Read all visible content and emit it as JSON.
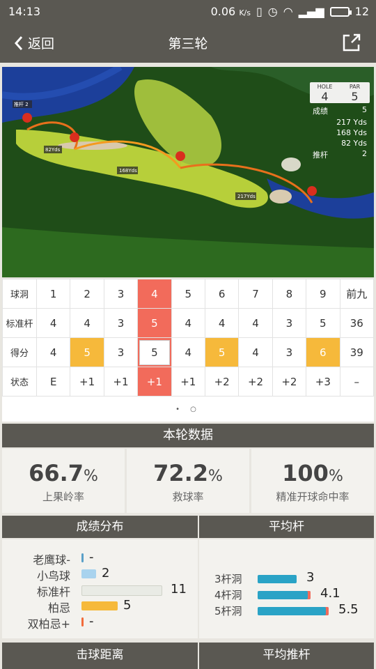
{
  "status_bar": {
    "time": "14:13",
    "speed": "0.06",
    "speed_unit": "K/s",
    "battery": "12"
  },
  "navbar": {
    "back_label": "返回",
    "title": "第三轮",
    "share_icon": "share-icon"
  },
  "map": {
    "putt_label": "推杆 2",
    "distances": [
      "82Yds",
      "168Yds",
      "217Yds"
    ],
    "hole_label": "HOLE",
    "hole": "4",
    "par_label": "PAR",
    "par": "5",
    "info": [
      {
        "k": "成绩",
        "v": "5"
      },
      {
        "k": "",
        "v": "217  Yds"
      },
      {
        "k": "",
        "v": "168  Yds"
      },
      {
        "k": "",
        "v": "82  Yds"
      },
      {
        "k": "推杆",
        "v": "2"
      }
    ]
  },
  "scorecard": {
    "labels": {
      "hole": "球洞",
      "par": "标准杆",
      "score": "得分",
      "status": "状态"
    },
    "holes": [
      "1",
      "2",
      "3",
      "4",
      "5",
      "6",
      "7",
      "8",
      "9"
    ],
    "front_label": "前九",
    "pars": [
      "4",
      "4",
      "3",
      "5",
      "4",
      "4",
      "4",
      "3",
      "5"
    ],
    "par_total": "36",
    "scores": [
      "4",
      "5",
      "3",
      "5",
      "4",
      "5",
      "4",
      "3",
      "6"
    ],
    "score_total": "39",
    "status": [
      "E",
      "+1",
      "+1",
      "+1",
      "+1",
      "+2",
      "+2",
      "+2",
      "+3"
    ],
    "status_total": "–",
    "selected_hole": 4,
    "pager": "• ○"
  },
  "round_data": {
    "title": "本轮数据",
    "stats": [
      {
        "value": "66.7",
        "unit": "%",
        "label": "上果岭率"
      },
      {
        "value": "72.2",
        "unit": "%",
        "label": "救球率"
      },
      {
        "value": "100",
        "unit": "%",
        "label": "精准开球命中率"
      }
    ]
  },
  "score_dist": {
    "title": "成绩分布",
    "rows": [
      {
        "name": "老鹰球-",
        "value": "-",
        "count": 0,
        "color": "#5aa0c8"
      },
      {
        "name": "小鸟球",
        "value": "2",
        "count": 2,
        "color": "#a9d3ee"
      },
      {
        "name": "标准杆",
        "value": "11",
        "count": 11,
        "color": "#e9ebe5"
      },
      {
        "name": "柏忌",
        "value": "5",
        "count": 5,
        "color": "#f6b93b"
      },
      {
        "name": "双柏忌+",
        "value": "-",
        "count": 0,
        "color": "#f26b3b"
      }
    ]
  },
  "avg_strokes": {
    "title": "平均杆",
    "rows": [
      {
        "name": "3杆洞",
        "value": "3",
        "avg": 3
      },
      {
        "name": "4杆洞",
        "value": "4.1",
        "avg": 4.1
      },
      {
        "name": "5杆洞",
        "value": "5.5",
        "avg": 5.5
      }
    ]
  },
  "bottom": {
    "left_title": "击球距离",
    "right_title": "平均推杆"
  }
}
